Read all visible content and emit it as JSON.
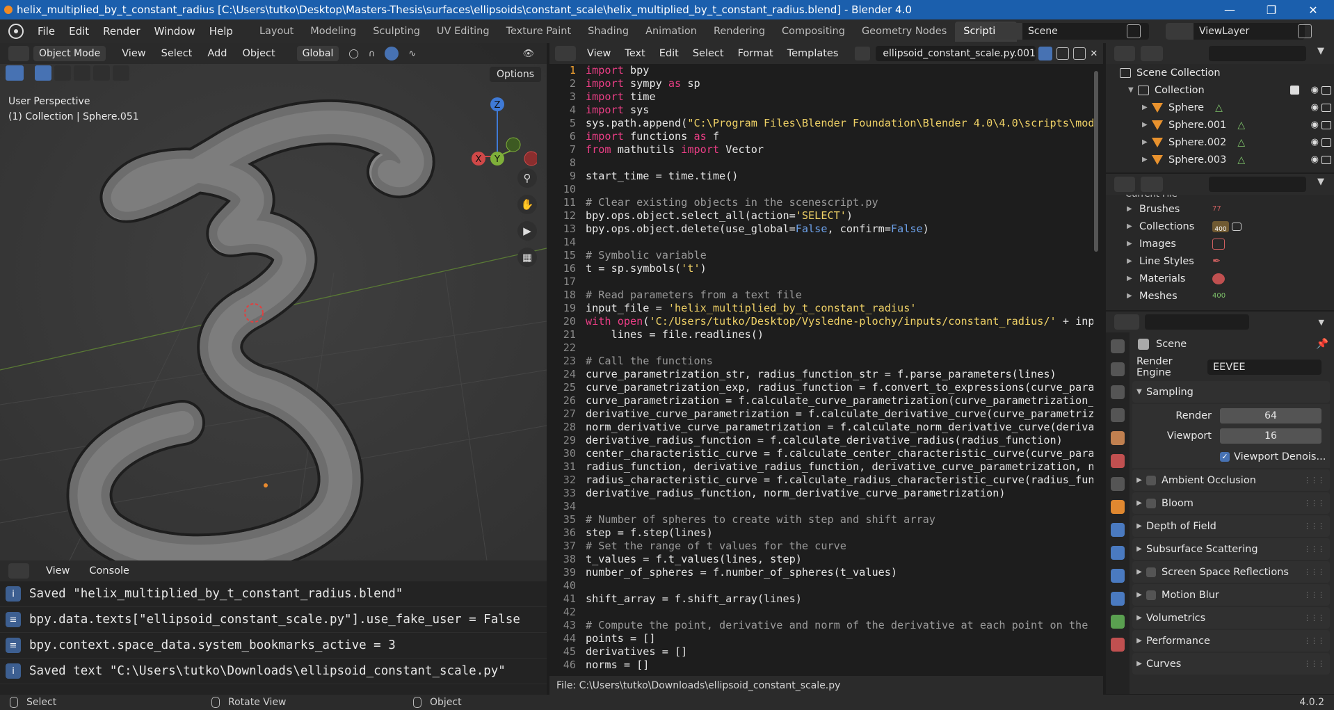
{
  "window": {
    "title": "helix_multiplied_by_t_constant_radius [C:\\Users\\tutko\\Desktop\\Masters-Thesis\\surfaces\\ellipsoids\\constant_scale\\helix_multiplied_by_t_constant_radius.blend] - Blender 4.0",
    "minimize": "—",
    "maximize": "❐",
    "close": "✕"
  },
  "menu": [
    "File",
    "Edit",
    "Render",
    "Window",
    "Help"
  ],
  "workspaces": [
    "Layout",
    "Modeling",
    "Sculpting",
    "UV Editing",
    "Texture Paint",
    "Shading",
    "Animation",
    "Rendering",
    "Compositing",
    "Geometry Nodes",
    "Scripting"
  ],
  "active_workspace": "Scripting",
  "scene_name": "Scene",
  "view_layer": "ViewLayer",
  "viewport": {
    "mode": "Object Mode",
    "menus": [
      "View",
      "Select",
      "Add",
      "Object"
    ],
    "orientation": "Global",
    "options": "Options",
    "info_line1": "User Perspective",
    "info_line2": "(1) Collection | Sphere.051",
    "gizmo": {
      "z": "Z",
      "y": "Y",
      "x": "X"
    }
  },
  "console": {
    "menus": [
      "View",
      "Console"
    ],
    "lines": [
      {
        "icon": "info-icon",
        "text": "Saved \"helix_multiplied_by_t_constant_radius.blend\""
      },
      {
        "icon": "operator-icon",
        "text": "bpy.data.texts[\"ellipsoid_constant_scale.py\"].use_fake_user = False"
      },
      {
        "icon": "operator-icon",
        "text": "bpy.context.space_data.system_bookmarks_active = 3"
      },
      {
        "icon": "info-icon",
        "text": "Saved text \"C:\\Users\\tutko\\Downloads\\ellipsoid_constant_scale.py\""
      }
    ]
  },
  "editor": {
    "menus": [
      "View",
      "Text",
      "Edit",
      "Select",
      "Format",
      "Templates"
    ],
    "file_name": "ellipsoid_constant_scale.py.001",
    "footer": "File: C:\\Users\\tutko\\Downloads\\ellipsoid_constant_scale.py",
    "lines": [
      "import bpy",
      "import sympy as sp",
      "import time",
      "import sys",
      "sys.path.append(\"C:\\Program Files\\Blender Foundation\\Blender 4.0\\4.0\\scripts\\modu",
      "import functions as f",
      "from mathutils import Vector",
      "",
      "start_time = time.time()",
      "",
      "# Clear existing objects in the scenescript.py",
      "bpy.ops.object.select_all(action='SELECT')",
      "bpy.ops.object.delete(use_global=False, confirm=False)",
      "",
      "# Symbolic variable",
      "t = sp.symbols('t')",
      "",
      "# Read parameters from a text file",
      "input_file = 'helix_multiplied_by_t_constant_radius'",
      "with open('C:/Users/tutko/Desktop/Vysledne-plochy/inputs/constant_radius/' + inpu",
      "    lines = file.readlines()",
      "",
      "# Call the functions",
      "curve_parametrization_str, radius_function_str = f.parse_parameters(lines)",
      "curve_parametrization_exp, radius_function = f.convert_to_expressions(curve_param",
      "curve_parametrization = f.calculate_curve_parametrization(curve_parametrization_e",
      "derivative_curve_parametrization = f.calculate_derivative_curve(curve_parametriza",
      "norm_derivative_curve_parametrization = f.calculate_norm_derivative_curve(derivat",
      "derivative_radius_function = f.calculate_derivative_radius(radius_function)",
      "center_characteristic_curve = f.calculate_center_characteristic_curve(curve_param",
      "radius_function, derivative_radius_function, derivative_curve_parametrization, no",
      "radius_characteristic_curve = f.calculate_radius_characteristic_curve(radius_func",
      "derivative_radius_function, norm_derivative_curve_parametrization)",
      "",
      "# Number of spheres to create with step and shift array",
      "step = f.step(lines)",
      "# Set the range of t values for the curve",
      "t_values = f.t_values(lines, step)",
      "number_of_spheres = f.number_of_spheres(t_values)",
      "",
      "shift_array = f.shift_array(lines)",
      "",
      "# Compute the point, derivative and norm of the derivative at each point on the c",
      "points = []",
      "derivatives = []",
      "norms = []"
    ]
  },
  "outliner": {
    "root": "Scene Collection",
    "collection": "Collection",
    "items": [
      "Sphere",
      "Sphere.001",
      "Sphere.002",
      "Sphere.003"
    ]
  },
  "file_browser": {
    "header_partial": "Current File",
    "items": [
      {
        "label": "Brushes",
        "badge": "77"
      },
      {
        "label": "Collections",
        "badge": "400"
      },
      {
        "label": "Images",
        "badge": ""
      },
      {
        "label": "Line Styles",
        "badge": ""
      },
      {
        "label": "Materials",
        "badge": ""
      },
      {
        "label": "Meshes",
        "badge": "400"
      }
    ]
  },
  "properties": {
    "context": "Scene",
    "render_engine_label": "Render Engine",
    "render_engine": "EEVEE",
    "sampling": "Sampling",
    "render_label": "Render",
    "render_value": "64",
    "viewport_label": "Viewport",
    "viewport_value": "16",
    "denoise_label": "Viewport Denois...",
    "panels": [
      "Ambient Occlusion",
      "Bloom",
      "Depth of Field",
      "Subsurface Scattering",
      "Screen Space Reflections",
      "Motion Blur",
      "Volumetrics",
      "Performance",
      "Curves"
    ]
  },
  "status": {
    "items": [
      "Select",
      "Rotate View",
      "Object"
    ],
    "version": "4.0.2"
  },
  "colors": {
    "accent": "#4772b3",
    "title_bar": "#1b5fad",
    "keyword": "#ec3e86",
    "string": "#efd166",
    "comment": "#9a9a9a",
    "builtin": "#6ca0e8"
  }
}
